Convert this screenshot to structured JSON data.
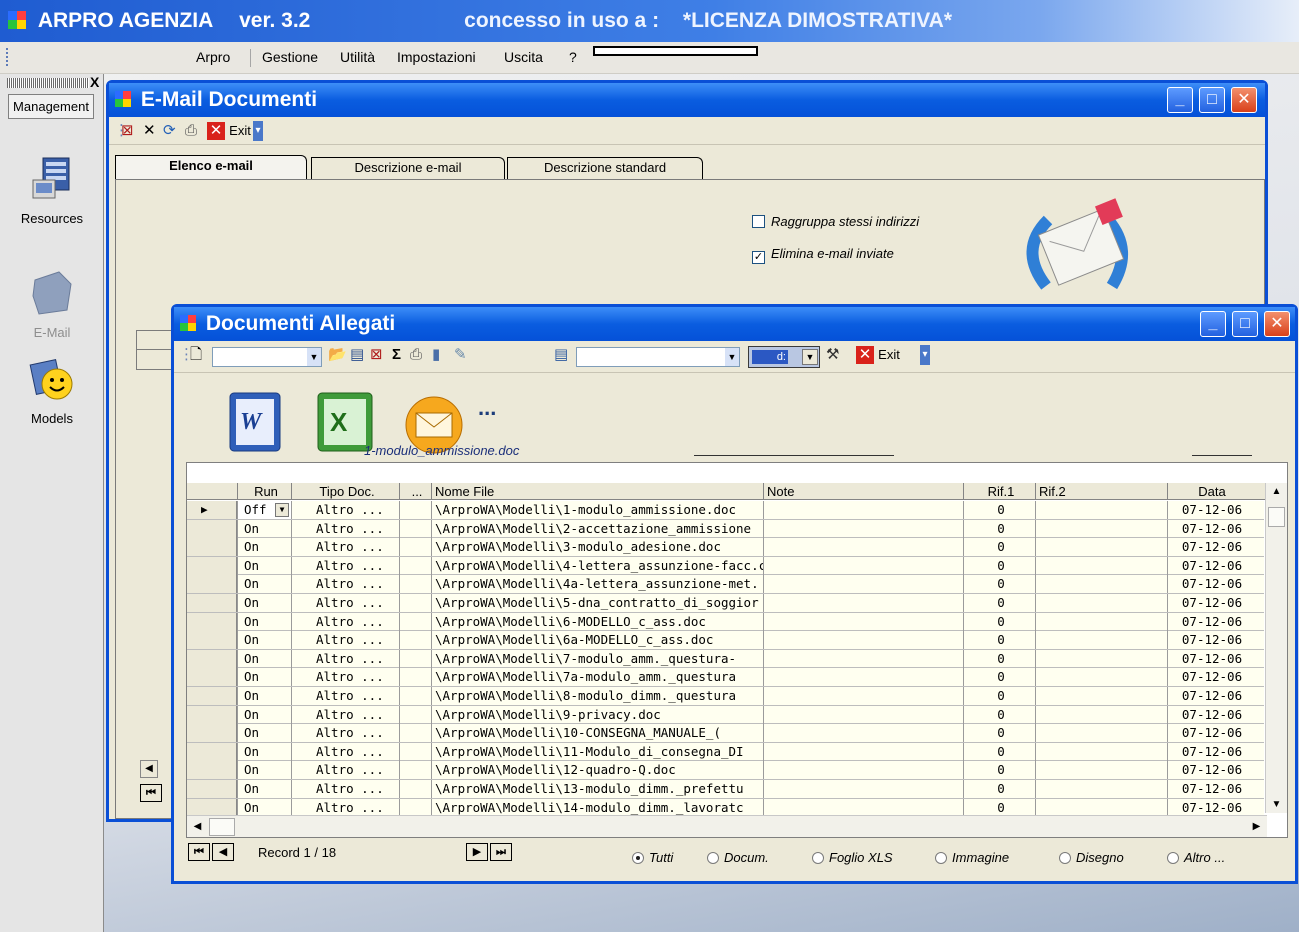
{
  "app": {
    "title": "ARPRO AGENZIA",
    "version": "ver. 3.2",
    "license_label": "concesso in uso a :",
    "license_value": "*LICENZA DIMOSTRATIVA*"
  },
  "menu": [
    "Arpro",
    "Gestione",
    "Utilità",
    "Impostazioni",
    "Uscita",
    "?"
  ],
  "left_panel": {
    "close_glyph": "X",
    "header_button": "Management",
    "items": [
      {
        "label": "Resources",
        "icon": "resources-icon"
      },
      {
        "label": "E-Mail",
        "icon": "email-icon"
      },
      {
        "label": "Models",
        "icon": "models-icon"
      }
    ]
  },
  "email_window": {
    "title": "E-Mail Documenti",
    "toolbar_exit": "Exit",
    "tabs": [
      "Elenco e-mail",
      "Descrizione e-mail",
      "Descrizione standard"
    ],
    "checkboxes": [
      {
        "label": "Raggruppa stessi indirizzi",
        "checked": false
      },
      {
        "label": "Elimina e-mail inviate",
        "checked": true
      }
    ]
  },
  "docs_window": {
    "title": "Documenti Allegati",
    "toolbar_exit": "Exit",
    "toolbar_drive": "d:",
    "sigma": "Σ",
    "app_icons": [
      "word-icon",
      "excel-icon",
      "outlook-icon"
    ],
    "more_glyph": "...",
    "selected_file": "1-modulo_ammissione.doc",
    "columns": [
      "Run",
      "Tipo Doc.",
      "...",
      "Nome File",
      "Note",
      "Rif.1",
      "Rif.2",
      "Data"
    ],
    "rows": [
      {
        "run": "Off",
        "tipo": "Altro ...",
        "file": "\\ArproWA\\Modelli\\1-modulo_ammissione.doc",
        "note": "",
        "rif1": "0",
        "rif2": "",
        "data": "07-12-06"
      },
      {
        "run": "On",
        "tipo": "Altro ...",
        "file": "\\ArproWA\\Modelli\\2-accettazione_ammissione",
        "note": "",
        "rif1": "0",
        "rif2": "",
        "data": "07-12-06"
      },
      {
        "run": "On",
        "tipo": "Altro ...",
        "file": "\\ArproWA\\Modelli\\3-modulo_adesione.doc",
        "note": "",
        "rif1": "0",
        "rif2": "",
        "data": "07-12-06"
      },
      {
        "run": "On",
        "tipo": "Altro ...",
        "file": "\\ArproWA\\Modelli\\4-lettera_assunzione-facc.c",
        "note": "",
        "rif1": "0",
        "rif2": "",
        "data": "07-12-06"
      },
      {
        "run": "On",
        "tipo": "Altro ...",
        "file": "\\ArproWA\\Modelli\\4a-lettera_assunzione-met.",
        "note": "",
        "rif1": "0",
        "rif2": "",
        "data": "07-12-06"
      },
      {
        "run": "On",
        "tipo": "Altro ...",
        "file": "\\ArproWA\\Modelli\\5-dna_contratto_di_soggior",
        "note": "",
        "rif1": "0",
        "rif2": "",
        "data": "07-12-06"
      },
      {
        "run": "On",
        "tipo": "Altro ...",
        "file": "\\ArproWA\\Modelli\\6-MODELLO_c_ass.doc",
        "note": "",
        "rif1": "0",
        "rif2": "",
        "data": "07-12-06"
      },
      {
        "run": "On",
        "tipo": "Altro ...",
        "file": "\\ArproWA\\Modelli\\6a-MODELLO_c_ass.doc",
        "note": "",
        "rif1": "0",
        "rif2": "",
        "data": "07-12-06"
      },
      {
        "run": "On",
        "tipo": "Altro ...",
        "file": "\\ArproWA\\Modelli\\7-modulo_amm._questura-",
        "note": "",
        "rif1": "0",
        "rif2": "",
        "data": "07-12-06"
      },
      {
        "run": "On",
        "tipo": "Altro ...",
        "file": "\\ArproWA\\Modelli\\7a-modulo_amm._questura",
        "note": "",
        "rif1": "0",
        "rif2": "",
        "data": "07-12-06"
      },
      {
        "run": "On",
        "tipo": "Altro ...",
        "file": "\\ArproWA\\Modelli\\8-modulo_dimm._questura",
        "note": "",
        "rif1": "0",
        "rif2": "",
        "data": "07-12-06"
      },
      {
        "run": "On",
        "tipo": "Altro ...",
        "file": "\\ArproWA\\Modelli\\9-privacy.doc",
        "note": "",
        "rif1": "0",
        "rif2": "",
        "data": "07-12-06"
      },
      {
        "run": "On",
        "tipo": "Altro ...",
        "file": "\\ArproWA\\Modelli\\10-CONSEGNA_MANUALE_(",
        "note": "",
        "rif1": "0",
        "rif2": "",
        "data": "07-12-06"
      },
      {
        "run": "On",
        "tipo": "Altro ...",
        "file": "\\ArproWA\\Modelli\\11-Modulo_di_consegna_DI",
        "note": "",
        "rif1": "0",
        "rif2": "",
        "data": "07-12-06"
      },
      {
        "run": "On",
        "tipo": "Altro ...",
        "file": "\\ArproWA\\Modelli\\12-quadro-Q.doc",
        "note": "",
        "rif1": "0",
        "rif2": "",
        "data": "07-12-06"
      },
      {
        "run": "On",
        "tipo": "Altro ...",
        "file": "\\ArproWA\\Modelli\\13-modulo_dimm._prefettu",
        "note": "",
        "rif1": "0",
        "rif2": "",
        "data": "07-12-06"
      },
      {
        "run": "On",
        "tipo": "Altro ...",
        "file": "\\ArproWA\\Modelli\\14-modulo_dimm._lavoratc",
        "note": "",
        "rif1": "0",
        "rif2": "",
        "data": "07-12-06"
      }
    ],
    "record_label": "Record 1 / 18",
    "filters": [
      {
        "label": "Tutti",
        "selected": true
      },
      {
        "label": "Docum.",
        "selected": false
      },
      {
        "label": "Foglio XLS",
        "selected": false
      },
      {
        "label": "Immagine",
        "selected": false
      },
      {
        "label": "Disegno",
        "selected": false
      },
      {
        "label": "Altro ...",
        "selected": false
      }
    ]
  }
}
